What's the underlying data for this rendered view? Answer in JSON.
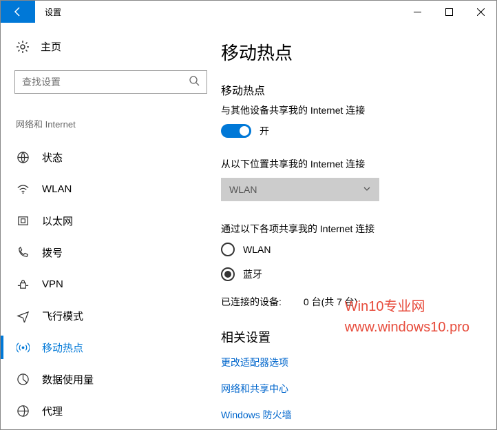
{
  "window": {
    "title": "设置"
  },
  "sidebar": {
    "home": "主页",
    "search_placeholder": "查找设置",
    "category": "网络和 Internet",
    "items": [
      {
        "label": "状态"
      },
      {
        "label": "WLAN"
      },
      {
        "label": "以太网"
      },
      {
        "label": "拨号"
      },
      {
        "label": "VPN"
      },
      {
        "label": "飞行模式"
      },
      {
        "label": "移动热点"
      },
      {
        "label": "数据使用量"
      },
      {
        "label": "代理"
      }
    ]
  },
  "main": {
    "title": "移动热点",
    "toggle_section": "移动热点",
    "toggle_sub": "与其他设备共享我的 Internet 连接",
    "toggle_state": "开",
    "share_from_label": "从以下位置共享我的 Internet 连接",
    "share_from_value": "WLAN",
    "share_over_label": "通过以下各项共享我的 Internet 连接",
    "radio_wlan": "WLAN",
    "radio_bluetooth": "蓝牙",
    "connected_label": "已连接的设备:",
    "connected_value": "0 台(共 7 台)",
    "related_title": "相关设置",
    "link_adapter": "更改适配器选项",
    "link_sharing": "网络和共享中心",
    "link_firewall": "Windows 防火墙"
  },
  "watermark": {
    "line1": "Win10专业网",
    "line2": "www.windows10.pro"
  }
}
